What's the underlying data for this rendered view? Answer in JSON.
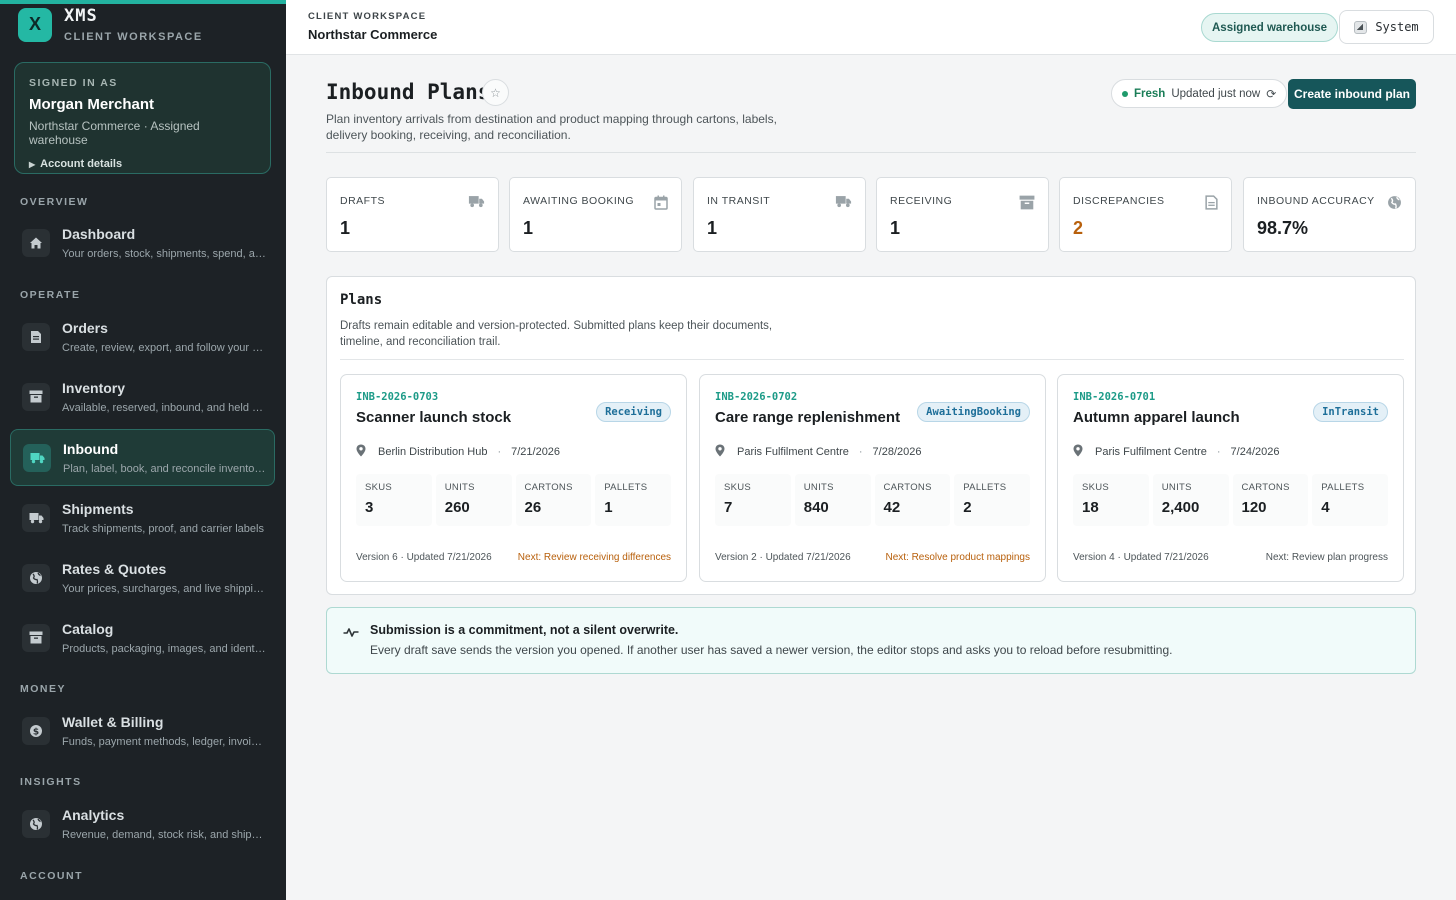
{
  "brand": {
    "logo_letter": "X",
    "name": "XMS",
    "subtitle": "CLIENT WORKSPACE"
  },
  "account": {
    "signed_in_label": "SIGNED IN AS",
    "name": "Morgan Merchant",
    "org_line": "Northstar Commerce · Assigned warehouse",
    "details_label": "Account details"
  },
  "nav": {
    "sections": [
      "OVERVIEW",
      "OPERATE",
      "MONEY",
      "INSIGHTS",
      "ACCOUNT"
    ],
    "items": [
      {
        "title": "Dashboard",
        "desc": "Your orders, stock, shipments, spend, and s...",
        "icon": "home-icon"
      },
      {
        "title": "Orders",
        "desc": "Create, review, export, and follow your orders",
        "icon": "document-icon"
      },
      {
        "title": "Inventory",
        "desc": "Available, reserved, inbound, and held stock",
        "icon": "archive-icon"
      },
      {
        "title": "Inbound",
        "desc": "Plan, label, book, and reconcile inventory ar...",
        "icon": "truck-icon"
      },
      {
        "title": "Shipments",
        "desc": "Track shipments, proof, and carrier labels",
        "icon": "truck-icon"
      },
      {
        "title": "Rates & Quotes",
        "desc": "Your prices, surcharges, and live shipping q...",
        "icon": "globe-icon"
      },
      {
        "title": "Catalog",
        "desc": "Products, packaging, images, and identifiers",
        "icon": "archive-icon"
      },
      {
        "title": "Wallet & Billing",
        "desc": "Funds, payment methods, ledger, invoices, ...",
        "icon": "dollar-icon"
      },
      {
        "title": "Analytics",
        "desc": "Revenue, demand, stock risk, and shipping ...",
        "icon": "globe-icon"
      }
    ],
    "active": "Inbound"
  },
  "header": {
    "workspace_label": "CLIENT WORKSPACE",
    "org": "Northstar Commerce",
    "warehouse_pill": "Assigned warehouse",
    "system_label": "System"
  },
  "page": {
    "title": "Inbound Plans",
    "description": "Plan inventory arrivals from destination and product mapping through cartons, labels, delivery booking, receiving, and reconciliation.",
    "fresh_label": "Fresh",
    "updated_label": "Updated just now",
    "create_button": "Create inbound plan"
  },
  "stats": [
    {
      "label": "DRAFTS",
      "value": "1",
      "icon": "truck-icon"
    },
    {
      "label": "AWAITING BOOKING",
      "value": "1",
      "icon": "calendar-icon"
    },
    {
      "label": "IN TRANSIT",
      "value": "1",
      "icon": "truck-icon"
    },
    {
      "label": "RECEIVING",
      "value": "1",
      "icon": "archive-icon"
    },
    {
      "label": "DISCREPANCIES",
      "value": "2",
      "icon": "document-icon"
    },
    {
      "label": "INBOUND ACCURACY",
      "value": "98.7%",
      "icon": "globe-icon"
    }
  ],
  "plans": {
    "title": "Plans",
    "subtitle": "Drafts remain editable and version-protected. Submitted plans keep their documents, timeline, and reconciliation trail.",
    "metric_labels": [
      "SKUS",
      "UNITS",
      "CARTONS",
      "PALLETS"
    ],
    "items": [
      {
        "id": "INB-2026-0703",
        "name": "Scanner launch stock",
        "status": "Receiving",
        "location": "Berlin Distribution Hub",
        "date": "7/21/2026",
        "skus": "3",
        "units": "260",
        "cartons": "26",
        "pallets": "1",
        "version": "Version 6 · Updated 7/21/2026",
        "next": "Next: Review receiving differences"
      },
      {
        "id": "INB-2026-0702",
        "name": "Care range replenishment",
        "status": "AwaitingBooking",
        "location": "Paris Fulfilment Centre",
        "date": "7/28/2026",
        "skus": "7",
        "units": "840",
        "cartons": "42",
        "pallets": "2",
        "version": "Version 2 · Updated 7/21/2026",
        "next": "Next: Resolve product mappings"
      },
      {
        "id": "INB-2026-0701",
        "name": "Autumn apparel launch",
        "status": "InTransit",
        "location": "Paris Fulfilment Centre",
        "date": "7/24/2026",
        "skus": "18",
        "units": "2,400",
        "cartons": "120",
        "pallets": "4",
        "version": "Version 4 · Updated 7/21/2026",
        "next": "Next: Review plan progress"
      }
    ]
  },
  "notice": {
    "title": "Submission is a commitment, not a silent overwrite.",
    "text": "Every draft save sends the version you opened. If another user has saved a newer version, the editor stops and asks you to reload before resubmitting."
  },
  "colors": {
    "accent": "#23b3a0",
    "primary_button": "#16565a",
    "warning": "#b8600c",
    "sidebar_bg": "#1d2226"
  }
}
